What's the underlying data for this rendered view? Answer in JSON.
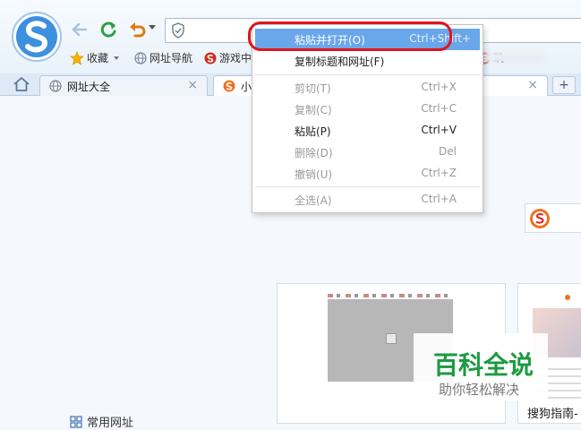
{
  "browser": {
    "favorites_label": "收藏",
    "nav_label": "网址导航",
    "games_label": "游戏中",
    "partial_bookmark": "玑"
  },
  "tabs": [
    {
      "label": "网址大全"
    },
    {
      "label": "小猪"
    }
  ],
  "new_tab_label": "+",
  "tab_close_glyph": "×",
  "context_menu": {
    "items": [
      {
        "label": "粘贴并打开(O)",
        "shortcut": "Ctrl+Shift+",
        "state": "highlighted"
      },
      {
        "label": "复制标题和网址(F)",
        "shortcut": "",
        "state": "enabled"
      },
      {
        "label": "剪切(T)",
        "shortcut": "Ctrl+X",
        "state": "disabled"
      },
      {
        "label": "复制(C)",
        "shortcut": "Ctrl+C",
        "state": "disabled"
      },
      {
        "label": "粘贴(P)",
        "shortcut": "Ctrl+V",
        "state": "enabled"
      },
      {
        "label": "删除(D)",
        "shortcut": "Del",
        "state": "disabled"
      },
      {
        "label": "撤销(U)",
        "shortcut": "Ctrl+Z",
        "state": "disabled"
      },
      {
        "label": "全选(A)",
        "shortcut": "Ctrl+A",
        "state": "disabled"
      }
    ]
  },
  "content": {
    "card2_title": "搜狗指南-",
    "common_sites_label": "常用网址"
  },
  "watermark": {
    "main": "百科全说",
    "sub": "助你轻松解决"
  },
  "colors": {
    "highlight": "#6aa6ea",
    "callout": "#e1141b",
    "watermark_green": "#1d9a42"
  }
}
